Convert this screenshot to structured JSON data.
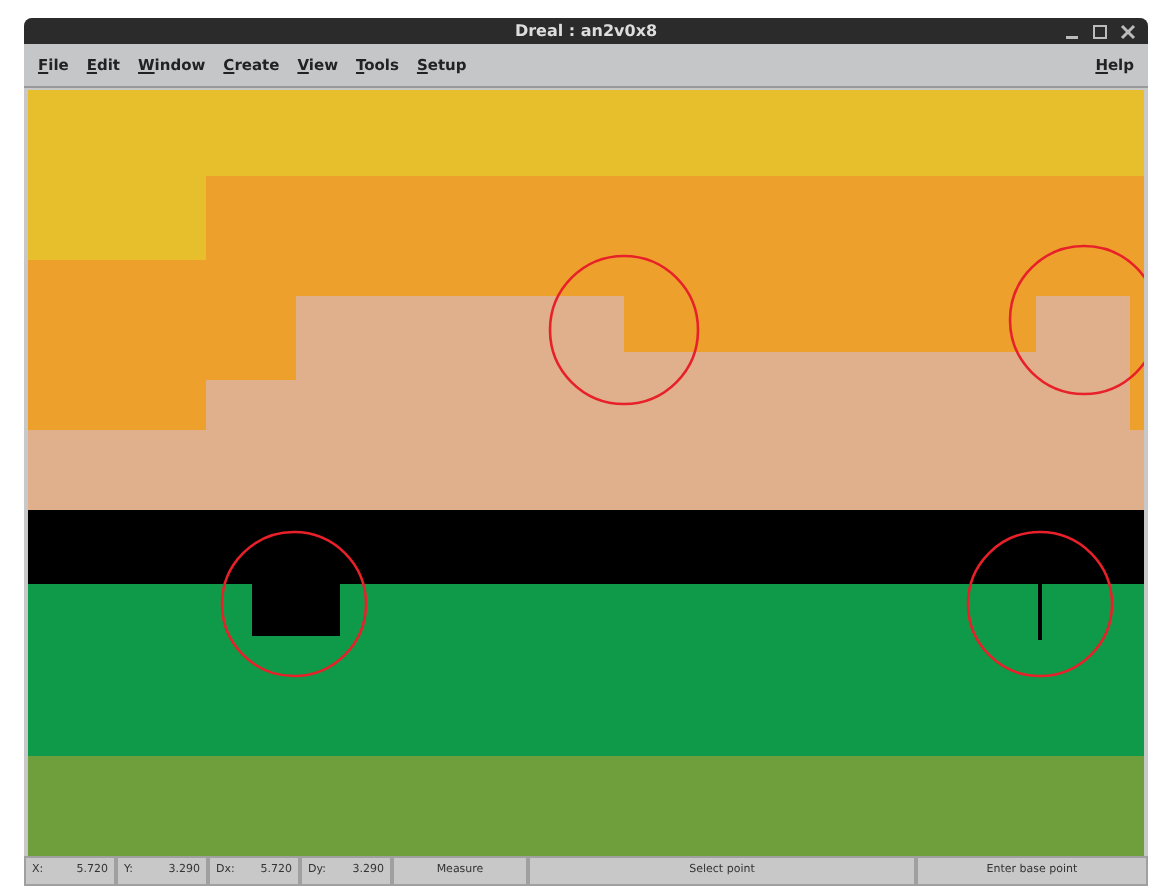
{
  "window": {
    "title": "Dreal : an2v0x8"
  },
  "menu": {
    "items": [
      {
        "label": "File"
      },
      {
        "label": "Edit"
      },
      {
        "label": "Window"
      },
      {
        "label": "Create"
      },
      {
        "label": "View"
      },
      {
        "label": "Tools"
      },
      {
        "label": "Setup"
      }
    ],
    "help": "Help"
  },
  "status_bar": {
    "coords": [
      {
        "label": "X:",
        "value": "5.720"
      },
      {
        "label": "Y:",
        "value": "3.290"
      },
      {
        "label": "Dx:",
        "value": "5.720"
      },
      {
        "label": "Dy:",
        "value": "3.290"
      }
    ],
    "mode": "Measure",
    "prompt": "Select point",
    "hint": "Enter base point"
  }
}
